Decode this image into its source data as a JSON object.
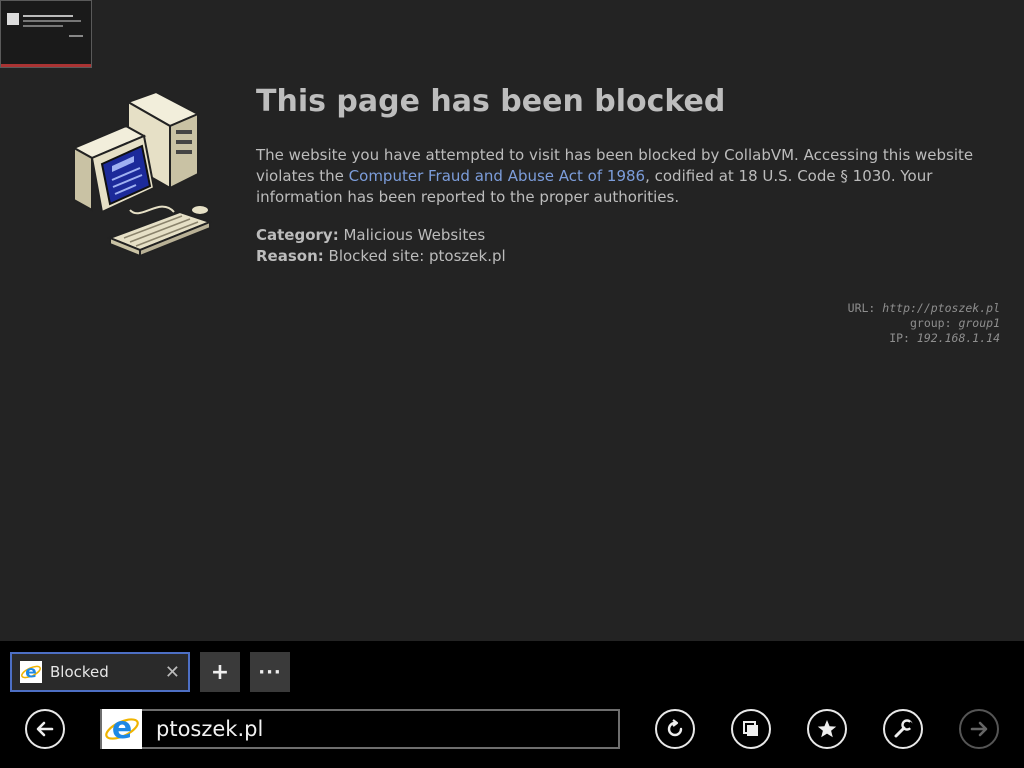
{
  "page": {
    "title": "This page has been blocked",
    "description_before": "The website you have attempted to visit has been blocked by CollabVM. Accessing this website violates the ",
    "link_text": "Computer Fraud and Abuse Act of 1986",
    "description_after": ", codified at 18 U.S. Code § 1030. Your information has been reported to the proper authorities.",
    "category_label": "Category:",
    "category_value": "Malicious Websites",
    "reason_label": "Reason:",
    "reason_value": "Blocked site: ptoszek.pl",
    "meta": {
      "url_label": "URL:",
      "url_value": "http://ptoszek.pl",
      "group_label": "group:",
      "group_value": "group1",
      "ip_label": "IP:",
      "ip_value": "192.168.1.14"
    }
  },
  "tabs": [
    {
      "label": "Blocked",
      "icon": "ie-icon",
      "active": true
    }
  ],
  "appbar": {
    "new_tab_symbol": "+",
    "more_symbol": "···",
    "close_symbol": "✕",
    "address_value": "ptoszek.pl",
    "buttons": [
      "back-icon",
      "refresh-icon",
      "tabs-icon",
      "favorite-icon",
      "tools-icon",
      "forward-icon"
    ]
  },
  "colors": {
    "background": "#232323",
    "appbar": "#000000",
    "link": "#7c9ddb",
    "tab_border": "#4d6fc4"
  }
}
